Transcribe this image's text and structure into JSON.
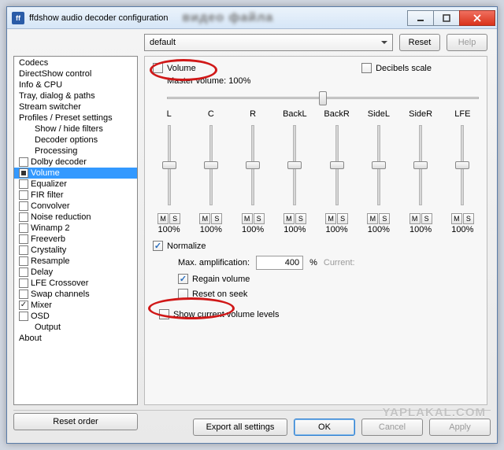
{
  "window": {
    "title": "ffdshow audio decoder configuration",
    "blurred_behind": "видео файла"
  },
  "titlebar_buttons": {
    "min": "minimize",
    "max": "maximize",
    "close": "close"
  },
  "preset": {
    "selected": "default",
    "reset": "Reset",
    "help": "Help"
  },
  "sidebar": {
    "items": [
      {
        "label": "Codecs",
        "indent": 0,
        "cb": null
      },
      {
        "label": "DirectShow control",
        "indent": 0,
        "cb": null
      },
      {
        "label": "Info & CPU",
        "indent": 0,
        "cb": null
      },
      {
        "label": "Tray, dialog & paths",
        "indent": 0,
        "cb": null
      },
      {
        "label": "Stream switcher",
        "indent": 0,
        "cb": null
      },
      {
        "label": "Profiles / Preset settings",
        "indent": 0,
        "cb": null
      },
      {
        "label": "Show / hide filters",
        "indent": 1,
        "cb": null
      },
      {
        "label": "Decoder options",
        "indent": 1,
        "cb": null
      },
      {
        "label": "Processing",
        "indent": 1,
        "cb": null
      },
      {
        "label": "Dolby decoder",
        "indent": 0,
        "cb": "empty"
      },
      {
        "label": "Volume",
        "indent": 0,
        "cb": "square",
        "selected": true
      },
      {
        "label": "Equalizer",
        "indent": 0,
        "cb": "empty"
      },
      {
        "label": "FIR filter",
        "indent": 0,
        "cb": "empty"
      },
      {
        "label": "Convolver",
        "indent": 0,
        "cb": "empty"
      },
      {
        "label": "Noise reduction",
        "indent": 0,
        "cb": "empty"
      },
      {
        "label": "Winamp 2",
        "indent": 0,
        "cb": "empty"
      },
      {
        "label": "Freeverb",
        "indent": 0,
        "cb": "empty"
      },
      {
        "label": "Crystality",
        "indent": 0,
        "cb": "empty"
      },
      {
        "label": "Resample",
        "indent": 0,
        "cb": "empty"
      },
      {
        "label": "Delay",
        "indent": 0,
        "cb": "empty"
      },
      {
        "label": "LFE Crossover",
        "indent": 0,
        "cb": "empty"
      },
      {
        "label": "Swap channels",
        "indent": 0,
        "cb": "empty"
      },
      {
        "label": "Mixer",
        "indent": 0,
        "cb": "checked"
      },
      {
        "label": "OSD",
        "indent": 0,
        "cb": "empty"
      },
      {
        "label": "Output",
        "indent": 1,
        "cb": null
      },
      {
        "label": "About",
        "indent": 0,
        "cb": null
      }
    ],
    "reset_order": "Reset order"
  },
  "volume": {
    "title": "Volume",
    "decibels": "Decibels scale",
    "master_label": "Master volume: 100%",
    "master_pos_pct": 50,
    "channels": [
      {
        "name": "L",
        "pct": "100%",
        "pos": 50
      },
      {
        "name": "C",
        "pct": "100%",
        "pos": 50
      },
      {
        "name": "R",
        "pct": "100%",
        "pos": 50
      },
      {
        "name": "BackL",
        "pct": "100%",
        "pos": 50
      },
      {
        "name": "BackR",
        "pct": "100%",
        "pos": 50
      },
      {
        "name": "SideL",
        "pct": "100%",
        "pos": 50
      },
      {
        "name": "SideR",
        "pct": "100%",
        "pos": 50
      },
      {
        "name": "LFE",
        "pct": "100%",
        "pos": 50
      }
    ],
    "ms": {
      "m": "M",
      "s": "S"
    },
    "normalize": "Normalize",
    "max_amp_label": "Max. amplification:",
    "max_amp_value": "400",
    "pct": "%",
    "current_label": "Current:",
    "regain": "Regain volume",
    "reset_seek": "Reset on seek",
    "show_levels": "Show current volume levels"
  },
  "footer": {
    "export": "Export all settings",
    "ok": "OK",
    "cancel": "Cancel",
    "apply": "Apply"
  },
  "watermark": "YAPLAKAL.COM"
}
